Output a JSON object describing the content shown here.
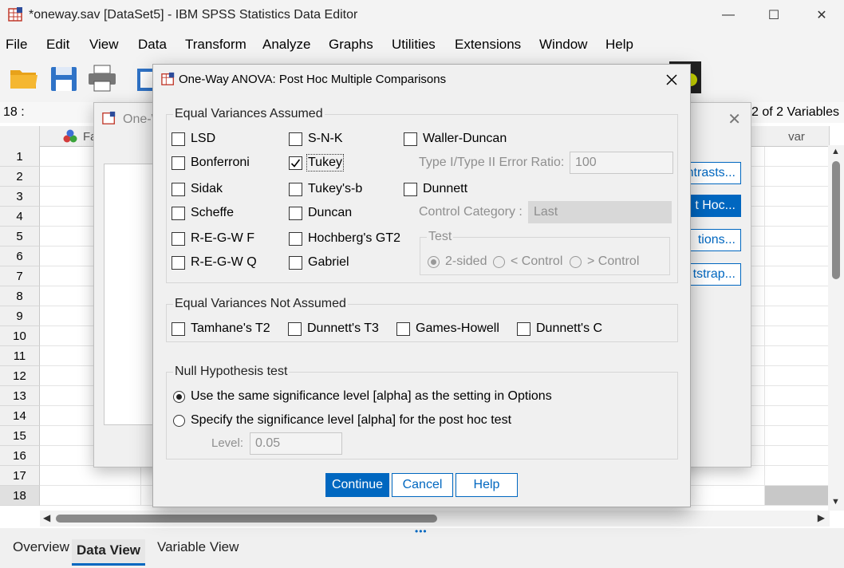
{
  "window": {
    "title": "*oneway.sav [DataSet5] - IBM SPSS Statistics Data Editor",
    "minimize_glyph": "—",
    "maximize_glyph": "☐",
    "close_glyph": "✕"
  },
  "menu": [
    "File",
    "Edit",
    "View",
    "Data",
    "Transform",
    "Analyze",
    "Graphs",
    "Utilities",
    "Extensions",
    "Window",
    "Help"
  ],
  "cellbar": {
    "ref": "18 :",
    "visible_vars": "2 of 2 Variables"
  },
  "grid": {
    "first_col_label": "Fa",
    "last_col_label": "var",
    "rows": [
      "1",
      "2",
      "3",
      "4",
      "5",
      "6",
      "7",
      "8",
      "9",
      "10",
      "11",
      "12",
      "13",
      "14",
      "15",
      "16",
      "17",
      "18"
    ]
  },
  "tabs": [
    "Overview",
    "Data View",
    "Variable View"
  ],
  "bg_dialog": {
    "title": "One-W",
    "buttons": [
      "ntrasts...",
      "t Hoc...",
      "tions...",
      "tstrap..."
    ]
  },
  "dialog": {
    "title": "One-Way ANOVA: Post Hoc Multiple Comparisons",
    "equal_assumed": {
      "label": "Equal Variances Assumed",
      "col1": [
        {
          "label": "LSD",
          "checked": false
        },
        {
          "label": "Bonferroni",
          "checked": false
        },
        {
          "label": "Sidak",
          "checked": false
        },
        {
          "label": "Scheffe",
          "checked": false
        },
        {
          "label": "R-E-G-W F",
          "checked": false
        },
        {
          "label": "R-E-G-W Q",
          "checked": false
        }
      ],
      "col2": [
        {
          "label": "S-N-K",
          "checked": false
        },
        {
          "label": "Tukey",
          "checked": true
        },
        {
          "label": "Tukey's-b",
          "checked": false
        },
        {
          "label": "Duncan",
          "checked": false
        },
        {
          "label": "Hochberg's GT2",
          "checked": false
        },
        {
          "label": "Gabriel",
          "checked": false
        }
      ],
      "waller": {
        "label": "Waller-Duncan",
        "checked": false
      },
      "ratio_label": "Type I/Type II Error Ratio:",
      "ratio_value": "100",
      "dunnett": {
        "label": "Dunnett",
        "checked": false
      },
      "control_label": "Control Category :",
      "control_value": "Last",
      "test_label": "Test",
      "test_options": [
        {
          "label": "2-sided",
          "selected": true
        },
        {
          "label": "< Control",
          "selected": false
        },
        {
          "label": "> Control",
          "selected": false
        }
      ]
    },
    "not_assumed": {
      "label": "Equal Variances Not Assumed",
      "items": [
        {
          "label": "Tamhane's T2",
          "checked": false
        },
        {
          "label": "Dunnett's T3",
          "checked": false
        },
        {
          "label": "Games-Howell",
          "checked": false
        },
        {
          "label": "Dunnett's C",
          "checked": false
        }
      ]
    },
    "null_test": {
      "label": "Null Hypothesis test",
      "options": [
        {
          "label": "Use the same significance level [alpha] as the setting in Options",
          "selected": true
        },
        {
          "label": "Specify the significance level [alpha] for the post hoc test",
          "selected": false
        }
      ],
      "level_label": "Level:",
      "level_value": "0.05"
    },
    "buttons": {
      "continue": "Continue",
      "cancel": "Cancel",
      "help": "Help"
    }
  }
}
